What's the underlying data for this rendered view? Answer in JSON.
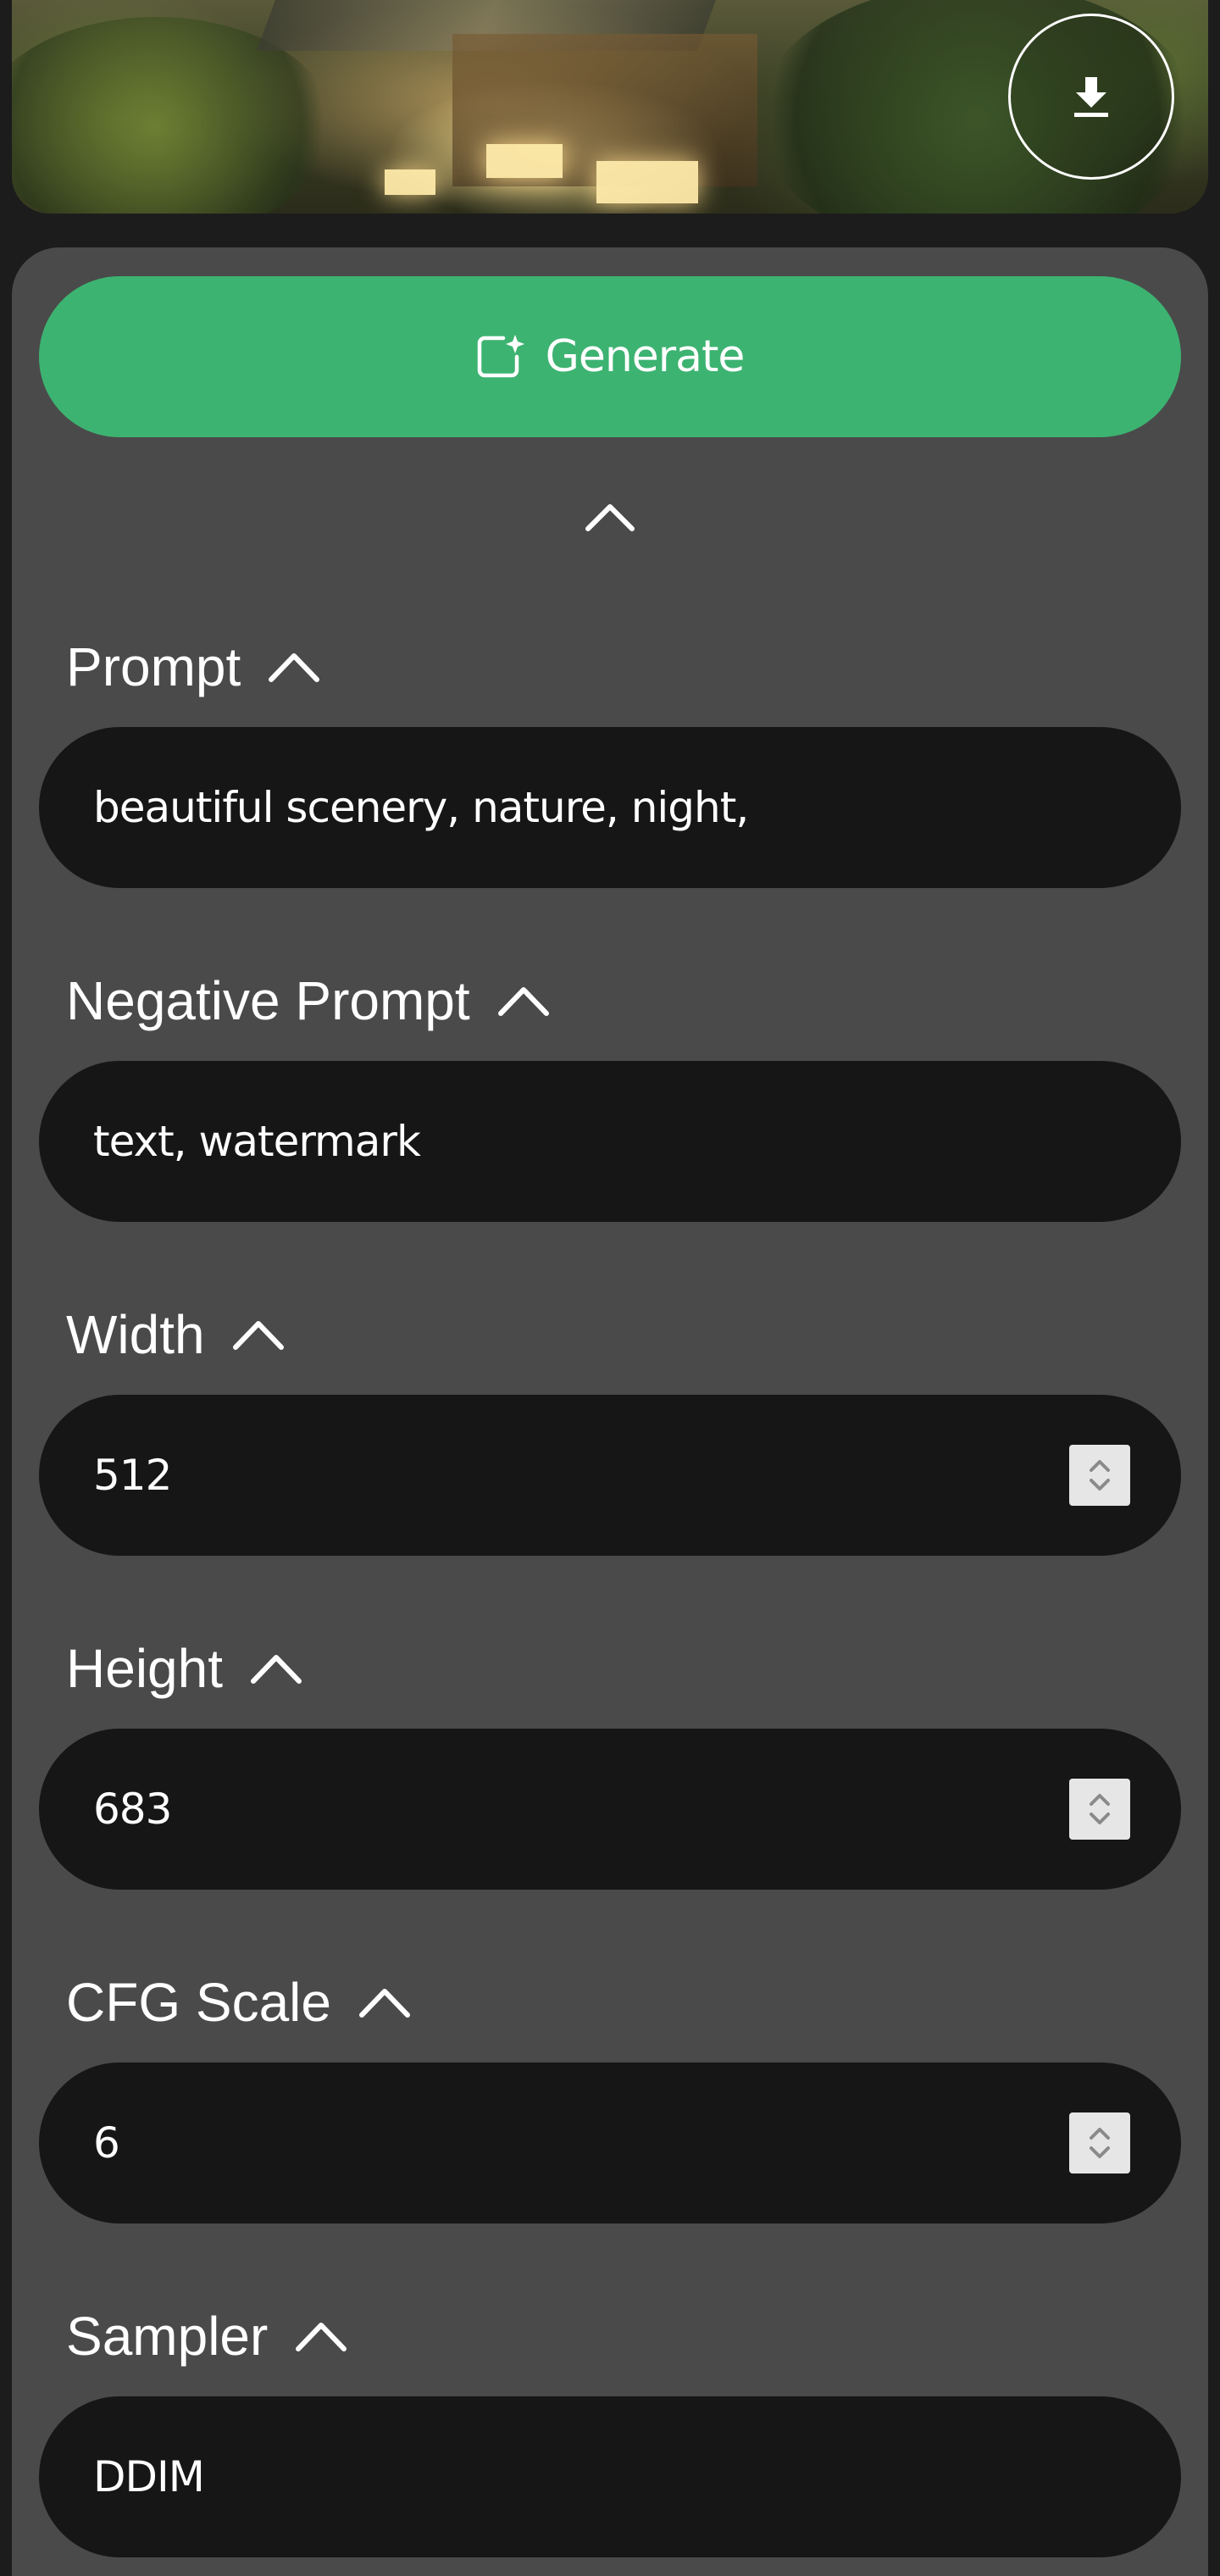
{
  "preview": {
    "download_icon": "download-icon"
  },
  "generate": {
    "label": "Generate",
    "icon": "sparkle-image-icon",
    "color": "#3db371"
  },
  "fields": {
    "prompt": {
      "label": "Prompt",
      "value": "beautiful scenery, nature, night,"
    },
    "negative_prompt": {
      "label": "Negative Prompt",
      "value": "text, watermark"
    },
    "width": {
      "label": "Width",
      "value": "512"
    },
    "height": {
      "label": "Height",
      "value": "683"
    },
    "cfg_scale": {
      "label": "CFG Scale",
      "value": "6"
    },
    "sampler": {
      "label": "Sampler",
      "value": "DDIM"
    }
  },
  "colors": {
    "panel": "#4a4a4a",
    "input": "#161616",
    "accent": "#3db371"
  }
}
